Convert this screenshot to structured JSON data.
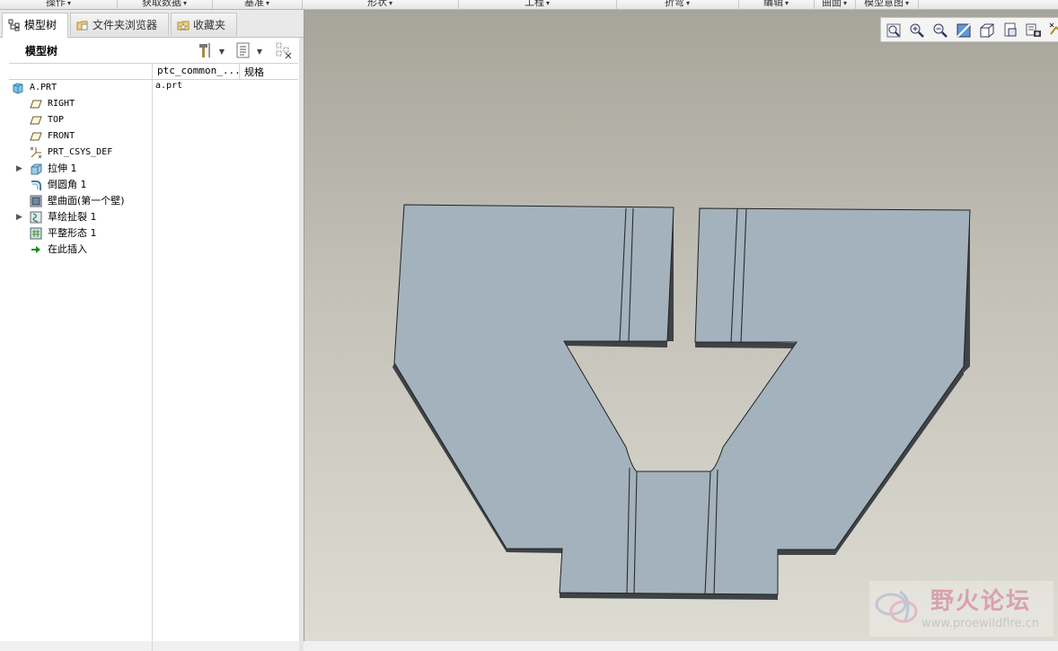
{
  "ribbon": {
    "groups": [
      "操作",
      "获取数据",
      "基准",
      "形状",
      "工程",
      "折弯",
      "编辑",
      "曲面",
      "模型意图"
    ]
  },
  "tabs": [
    {
      "label": "模型树",
      "icon": "model-tree-icon"
    },
    {
      "label": "文件夹浏览器",
      "icon": "folder-browser-icon"
    },
    {
      "label": "收藏夹",
      "icon": "favorites-icon"
    }
  ],
  "tree": {
    "title": "模型树",
    "columns": [
      "ptc_common_...",
      "规格"
    ],
    "cell_value": "a.prt",
    "items": [
      {
        "label": "A.PRT",
        "icon": "part-icon",
        "expandable": false,
        "mono": true
      },
      {
        "label": "RIGHT",
        "icon": "datum-plane-icon",
        "expandable": false,
        "mono": true
      },
      {
        "label": "TOP",
        "icon": "datum-plane-icon",
        "expandable": false,
        "mono": true
      },
      {
        "label": "FRONT",
        "icon": "datum-plane-icon",
        "expandable": false,
        "mono": true
      },
      {
        "label": "PRT_CSYS_DEF",
        "icon": "coordinate-system-icon",
        "expandable": false,
        "mono": true
      },
      {
        "label": "拉伸 1",
        "icon": "extrude-icon",
        "expandable": true,
        "mono": false
      },
      {
        "label": "倒圆角 1",
        "icon": "round-icon",
        "expandable": false,
        "mono": false
      },
      {
        "label": "壁曲面(第一个壁)",
        "icon": "wall-surface-icon",
        "expandable": false,
        "mono": false
      },
      {
        "label": "草绘扯裂 1",
        "icon": "sketch-rip-icon",
        "expandable": true,
        "mono": false
      },
      {
        "label": "平整形态 1",
        "icon": "flat-state-icon",
        "expandable": false,
        "mono": false
      },
      {
        "label": "在此插入",
        "icon": "insert-here-arrow-icon",
        "expandable": false,
        "mono": false
      }
    ]
  },
  "watermark": {
    "name": "野火论坛",
    "url": "www.proewildfire.cn"
  },
  "colors": {
    "part_face": "#a3b2bc",
    "part_edge": "#3f4346",
    "insert_arrow": "#1e8a1e"
  }
}
